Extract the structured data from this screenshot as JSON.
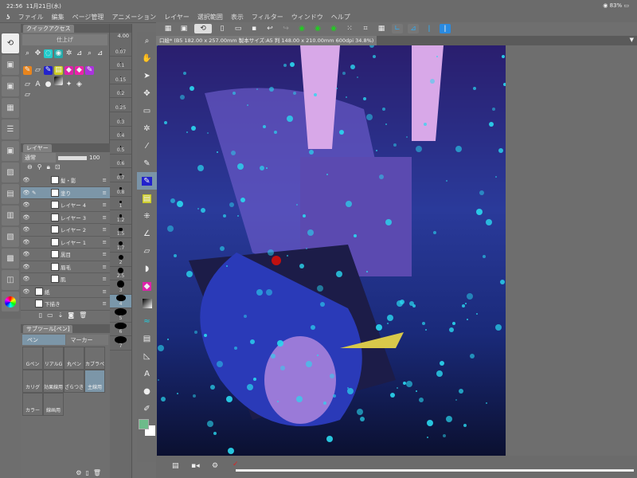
{
  "status": {
    "time": "22:56",
    "date": "11月21日(水)",
    "battery": "83%"
  },
  "menu": [
    "ファイル",
    "編集",
    "ページ管理",
    "アニメーション",
    "レイヤー",
    "選択範囲",
    "表示",
    "フィルター",
    "ウィンドウ",
    "ヘルプ"
  ],
  "document_tab": "口絵* (B5 182.00 x 257.00mm 製本サイズ:A5 判 148.00 x 210.00mm 600dpi 34.8%)",
  "quick_access": {
    "title": "クイックアクセス",
    "set": "仕上げ"
  },
  "layer_panel": {
    "title": "レイヤー",
    "blend": "通常",
    "opacity": "100",
    "layers": [
      {
        "name": "髪・影",
        "visible": true
      },
      {
        "name": "塗り",
        "visible": true,
        "selected": true
      },
      {
        "name": "レイヤー 4",
        "visible": true
      },
      {
        "name": "レイヤー 3",
        "visible": true
      },
      {
        "name": "レイヤー 2",
        "visible": true
      },
      {
        "name": "レイヤー 1",
        "visible": true
      },
      {
        "name": "黒目",
        "visible": true
      },
      {
        "name": "眉毛",
        "visible": true
      },
      {
        "name": "肌",
        "visible": true
      },
      {
        "name": "紙",
        "visible": true
      },
      {
        "name": "下描き",
        "visible": false
      }
    ]
  },
  "subtool": {
    "title": "サブツール[ペン]",
    "tabs": [
      "ペン",
      "マーカー"
    ],
    "items": [
      "Gペン",
      "リアルG",
      "丸ペン",
      "カブラペ",
      "カリグ",
      "効果線用",
      "ざらつき",
      "主線用",
      "カラー",
      "線画用"
    ],
    "selected": "主線用"
  },
  "brush_sizes": {
    "current": "4.00",
    "sizes": [
      "0.07",
      "0.1",
      "0.15",
      "0.2",
      "0.25",
      "0.3",
      "0.4",
      "0.5",
      "0.6",
      "0.7",
      "0.8",
      "1",
      "1.2",
      "1.5",
      "1.7",
      "2",
      "2.5",
      "3",
      "4",
      "5",
      "6",
      "7"
    ],
    "selected": "4"
  },
  "colors": {
    "main": "#6dbb8a",
    "sub": "#ffffff",
    "accent": "#7c96a8"
  }
}
